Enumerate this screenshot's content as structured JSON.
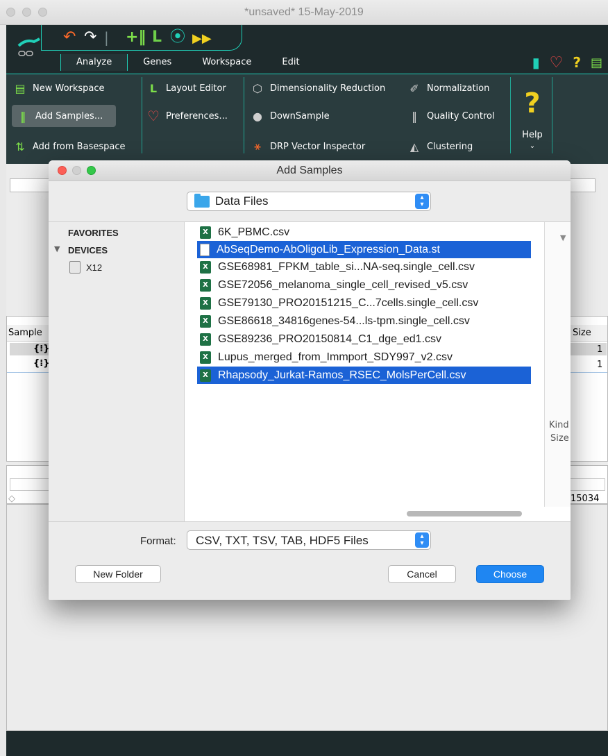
{
  "window": {
    "title": "*unsaved* 15-May-2019"
  },
  "menubar": {
    "items": [
      "Analyze",
      "Genes",
      "Workspace",
      "Edit"
    ],
    "active": "Analyze"
  },
  "ribbon": {
    "new_workspace": "New Workspace",
    "add_samples": "Add Samples...",
    "add_from_basespace": "Add from Basespace",
    "layout_editor": "Layout Editor",
    "preferences": "Preferences...",
    "dimensionality_reduction": "Dimensionality Reduction",
    "downsample": "DownSample",
    "drp_vector_inspector": "DRP Vector Inspector",
    "normalization": "Normalization",
    "quality_control": "Quality Control",
    "clustering": "Clustering",
    "help": "Help"
  },
  "background": {
    "sample_header": "Sample",
    "size_header": "Size",
    "size_values": [
      "1",
      "1"
    ],
    "bottom_value": "15034",
    "kind_label": "Kind",
    "size_label": "Size"
  },
  "dialog": {
    "title": "Add Samples",
    "location": "Data Files",
    "favorites": "FAVORITES",
    "devices": "DEVICES",
    "device_name": "X12",
    "files": [
      {
        "name": "6K_PBMC.csv",
        "type": "csv",
        "selected": false
      },
      {
        "name": "AbSeqDemo-AbOligoLib_Expression_Data.st",
        "type": "doc",
        "selected": true
      },
      {
        "name": "GSE68981_FPKM_table_si...NA-seq.single_cell.csv",
        "type": "csv",
        "selected": false
      },
      {
        "name": "GSE72056_melanoma_single_cell_revised_v5.csv",
        "type": "csv",
        "selected": false
      },
      {
        "name": "GSE79130_PRO20151215_C...7cells.single_cell.csv",
        "type": "csv",
        "selected": false
      },
      {
        "name": "GSE86618_34816genes-54...ls-tpm.single_cell.csv",
        "type": "csv",
        "selected": false
      },
      {
        "name": "GSE89236_PRO20150814_C1_dge_ed1.csv",
        "type": "csv",
        "selected": false
      },
      {
        "name": "Lupus_merged_from_Immport_SDY997_v2.csv",
        "type": "csv",
        "selected": false
      },
      {
        "name": "Rhapsody_Jurkat-Ramos_RSEC_MolsPerCell.csv",
        "type": "csv",
        "selected": true
      }
    ],
    "format_label": "Format:",
    "format_value": "CSV, TXT, TSV, TAB, HDF5 Files",
    "new_folder": "New Folder",
    "cancel": "Cancel",
    "choose": "Choose"
  },
  "colors": {
    "accent": "#20d0b8",
    "selection": "#1b62d6",
    "primary_button": "#1f86f2",
    "app_bar": "#1e2a2c"
  }
}
